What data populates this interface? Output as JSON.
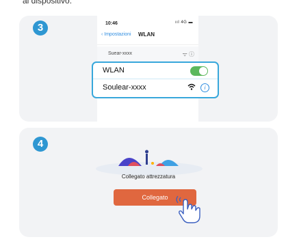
{
  "intro_text": "al dispositivo.",
  "step3": {
    "number": "3",
    "status": {
      "time": "10:46",
      "icons": "ııl 4G ▬"
    },
    "nav": {
      "back_label": "‹ Impostazioni",
      "title": "WLAN"
    },
    "ghost_row": {
      "name": "Suear-xxxx",
      "icons": "ᯤ ⓘ"
    },
    "zoom": {
      "wlan_label": "WLAN",
      "wlan_toggle_on": true,
      "network_name": "Soulear-xxxx",
      "wifi_icon": "ᯤ",
      "info_icon": "i"
    }
  },
  "step4": {
    "number": "4",
    "status_label": "Collegato attrezzatura",
    "button_label": "Collegato"
  },
  "colors": {
    "badge": "#2f97d2",
    "highlight_border": "#37a7db",
    "toggle_on": "#5cb85c",
    "button": "#e0673f",
    "link": "#2f8de0"
  },
  "icons": [
    "wifi-icon",
    "info-icon",
    "hand-pointer-icon",
    "back-chevron-icon"
  ]
}
